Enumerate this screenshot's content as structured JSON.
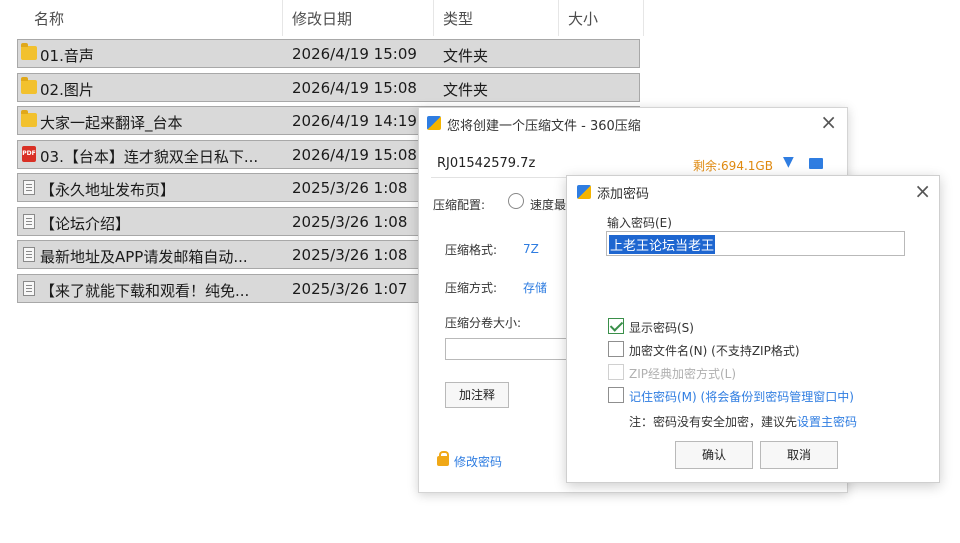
{
  "explorer": {
    "columns": {
      "name": "名称",
      "date": "修改日期",
      "type": "类型",
      "size": "大小"
    },
    "rows": [
      {
        "icon": "folder-icon",
        "name": "01.音声",
        "date": "2026/4/19 15:09",
        "type": "文件夹"
      },
      {
        "icon": "folder-icon",
        "name": "02.图片",
        "date": "2026/4/19 15:08",
        "type": "文件夹"
      },
      {
        "icon": "folder-icon",
        "name": "大家一起来翻译_台本",
        "date": "2026/4/19 14:19",
        "type": ""
      },
      {
        "icon": "pdf-icon",
        "name": "03.【台本】连才貌双全日私下...",
        "date": "2026/4/19 15:08",
        "type": ""
      },
      {
        "icon": "document-icon",
        "name": "【永久地址发布页】",
        "date": "2025/3/26 1:08",
        "type": ""
      },
      {
        "icon": "document-icon",
        "name": "【论坛介绍】",
        "date": "2025/3/26 1:08",
        "type": ""
      },
      {
        "icon": "document-icon",
        "name": "最新地址及APP请发邮箱自动...",
        "date": "2025/3/26 1:08",
        "type": ""
      },
      {
        "icon": "document-icon",
        "name": "【来了就能下载和观看！纯免...",
        "date": "2025/3/26 1:07",
        "type": ""
      }
    ]
  },
  "compress_window": {
    "title": "您将创建一个压缩文件 - 360压缩",
    "filename": "RJ01542579.7z",
    "free_space": "剩余:694.1GB",
    "config_label": "压缩配置:",
    "speed_option": "速度最",
    "format_label": "压缩格式:",
    "format_value": "7Z",
    "method_label": "压缩方式:",
    "method_value": "存储",
    "split_label": "压缩分卷大小:",
    "comment_button": "加注释",
    "change_password": "修改密码"
  },
  "password_dialog": {
    "title": "添加密码",
    "input_label": "输入密码(E)",
    "password_value": "上老王论坛当老王",
    "show_password": {
      "label": "显示密码(S)",
      "checked": true
    },
    "encrypt_names": {
      "label": "加密文件名(N) (不支持ZIP格式)",
      "checked": false
    },
    "zip_classic": {
      "label": "ZIP经典加密方式(L)",
      "checked": false,
      "disabled": true
    },
    "remember": {
      "label": "记住密码(M) (将会备份到密码管理窗口中)",
      "checked": false
    },
    "note_prefix": "注：密码没有安全加密，建议先",
    "note_link": "设置主密码",
    "ok_button": "确认",
    "cancel_button": "取消"
  },
  "colors": {
    "selection_row": "#d9d9d9",
    "accent_blue": "#2f7de1",
    "free_space_orange": "#e08a10",
    "selected_text_bg": "#1e66d0"
  }
}
